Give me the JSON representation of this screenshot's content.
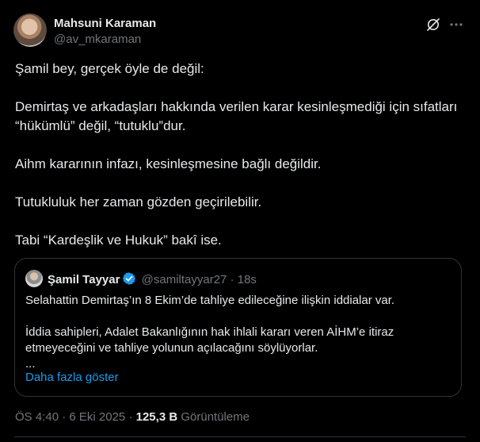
{
  "author": {
    "name": "Mahsuni Karaman",
    "handle": "@av_mkaraman"
  },
  "tweet": {
    "paragraphs": [
      "Şamil bey, gerçek öyle de değil:",
      "Demirtaş ve arkadaşları hakkında verilen karar kesinleşmediği için sıfatları “hükümlü” değil, “tutuklu”dur.",
      "Aihm kararının infazı, kesinleşmesine bağlı değildir.",
      "Tutukluluk her zaman gözden geçirilebilir.",
      "Tabi “Kardeşlik ve Hukuk” bakî ise."
    ]
  },
  "quote": {
    "name": "Şamil Tayyar",
    "handle": "@samiltayyar27",
    "separator": "·",
    "time": "18s",
    "paragraphs": [
      "Selahattin Demirtaş’ın 8 Ekim’de tahliye edileceğine ilişkin iddialar var.",
      "İddia sahipleri, Adalet Bakanlığının hak ihlali kararı veren AİHM’e itiraz etmeyeceğini ve tahliye yolunun açılacağını söylüyorlar.\n..."
    ],
    "show_more": "Daha fazla göster"
  },
  "footer": {
    "time": "ÖS 4:40",
    "separator": "·",
    "date": "6 Eki 2025",
    "views_count": "125,3 B",
    "views_label": "Görüntüleme"
  },
  "icons": {
    "grok": "grok-icon",
    "more": "more-icon",
    "verified": "verified-badge-icon"
  },
  "colors": {
    "background": "#000000",
    "text": "#e7e9ea",
    "muted": "#71767b",
    "link": "#1d9bf0",
    "verified": "#1d9bf0",
    "border": "#2f3336"
  }
}
